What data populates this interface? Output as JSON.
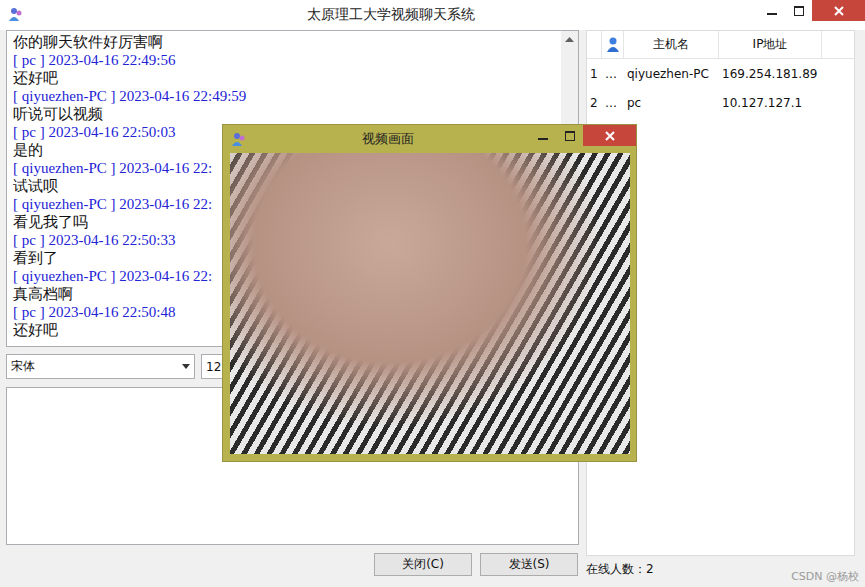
{
  "window": {
    "title": "太原理工大学视频聊天系统"
  },
  "chat_log": {
    "lines": [
      {
        "kind": "body",
        "text": "你的聊天软件好厉害啊"
      },
      {
        "kind": "header",
        "text": "[ pc ] 2023-04-16 22:49:56"
      },
      {
        "kind": "body",
        "text": "还好吧"
      },
      {
        "kind": "header",
        "text": "[ qiyuezhen-PC ] 2023-04-16 22:49:59"
      },
      {
        "kind": "body",
        "text": "听说可以视频"
      },
      {
        "kind": "header",
        "text": "[ pc ] 2023-04-16 22:50:03"
      },
      {
        "kind": "body",
        "text": "是的"
      },
      {
        "kind": "header",
        "text": "[ qiyuezhen-PC ] 2023-04-16 22:"
      },
      {
        "kind": "body",
        "text": "试试呗"
      },
      {
        "kind": "header",
        "text": "[ qiyuezhen-PC ] 2023-04-16 22:"
      },
      {
        "kind": "body",
        "text": "看见我了吗"
      },
      {
        "kind": "header",
        "text": "[ pc ] 2023-04-16 22:50:33"
      },
      {
        "kind": "body",
        "text": "看到了"
      },
      {
        "kind": "header",
        "text": "[ qiyuezhen-PC ] 2023-04-16 22:"
      },
      {
        "kind": "body",
        "text": "真高档啊"
      },
      {
        "kind": "header",
        "text": "[ pc ] 2023-04-16 22:50:48"
      },
      {
        "kind": "body",
        "text": "还好吧"
      }
    ]
  },
  "font_bar": {
    "font": "宋体",
    "size": "12"
  },
  "buttons": [
    {
      "label": "关闭(C)"
    },
    {
      "label": "发送(S)"
    }
  ],
  "users_table": {
    "columns": [
      "主机名",
      "IP地址"
    ],
    "rows": [
      {
        "index": "1",
        "mark": "…",
        "host": "qiyuezhen-PC",
        "ip": "169.254.181.89"
      },
      {
        "index": "2",
        "mark": "…",
        "host": "pc",
        "ip": "10.127.127.1"
      }
    ]
  },
  "status_bar": {
    "online": "在线人数：2"
  },
  "video_window": {
    "title": "视频画面"
  },
  "watermark": "CSDN @杨校"
}
